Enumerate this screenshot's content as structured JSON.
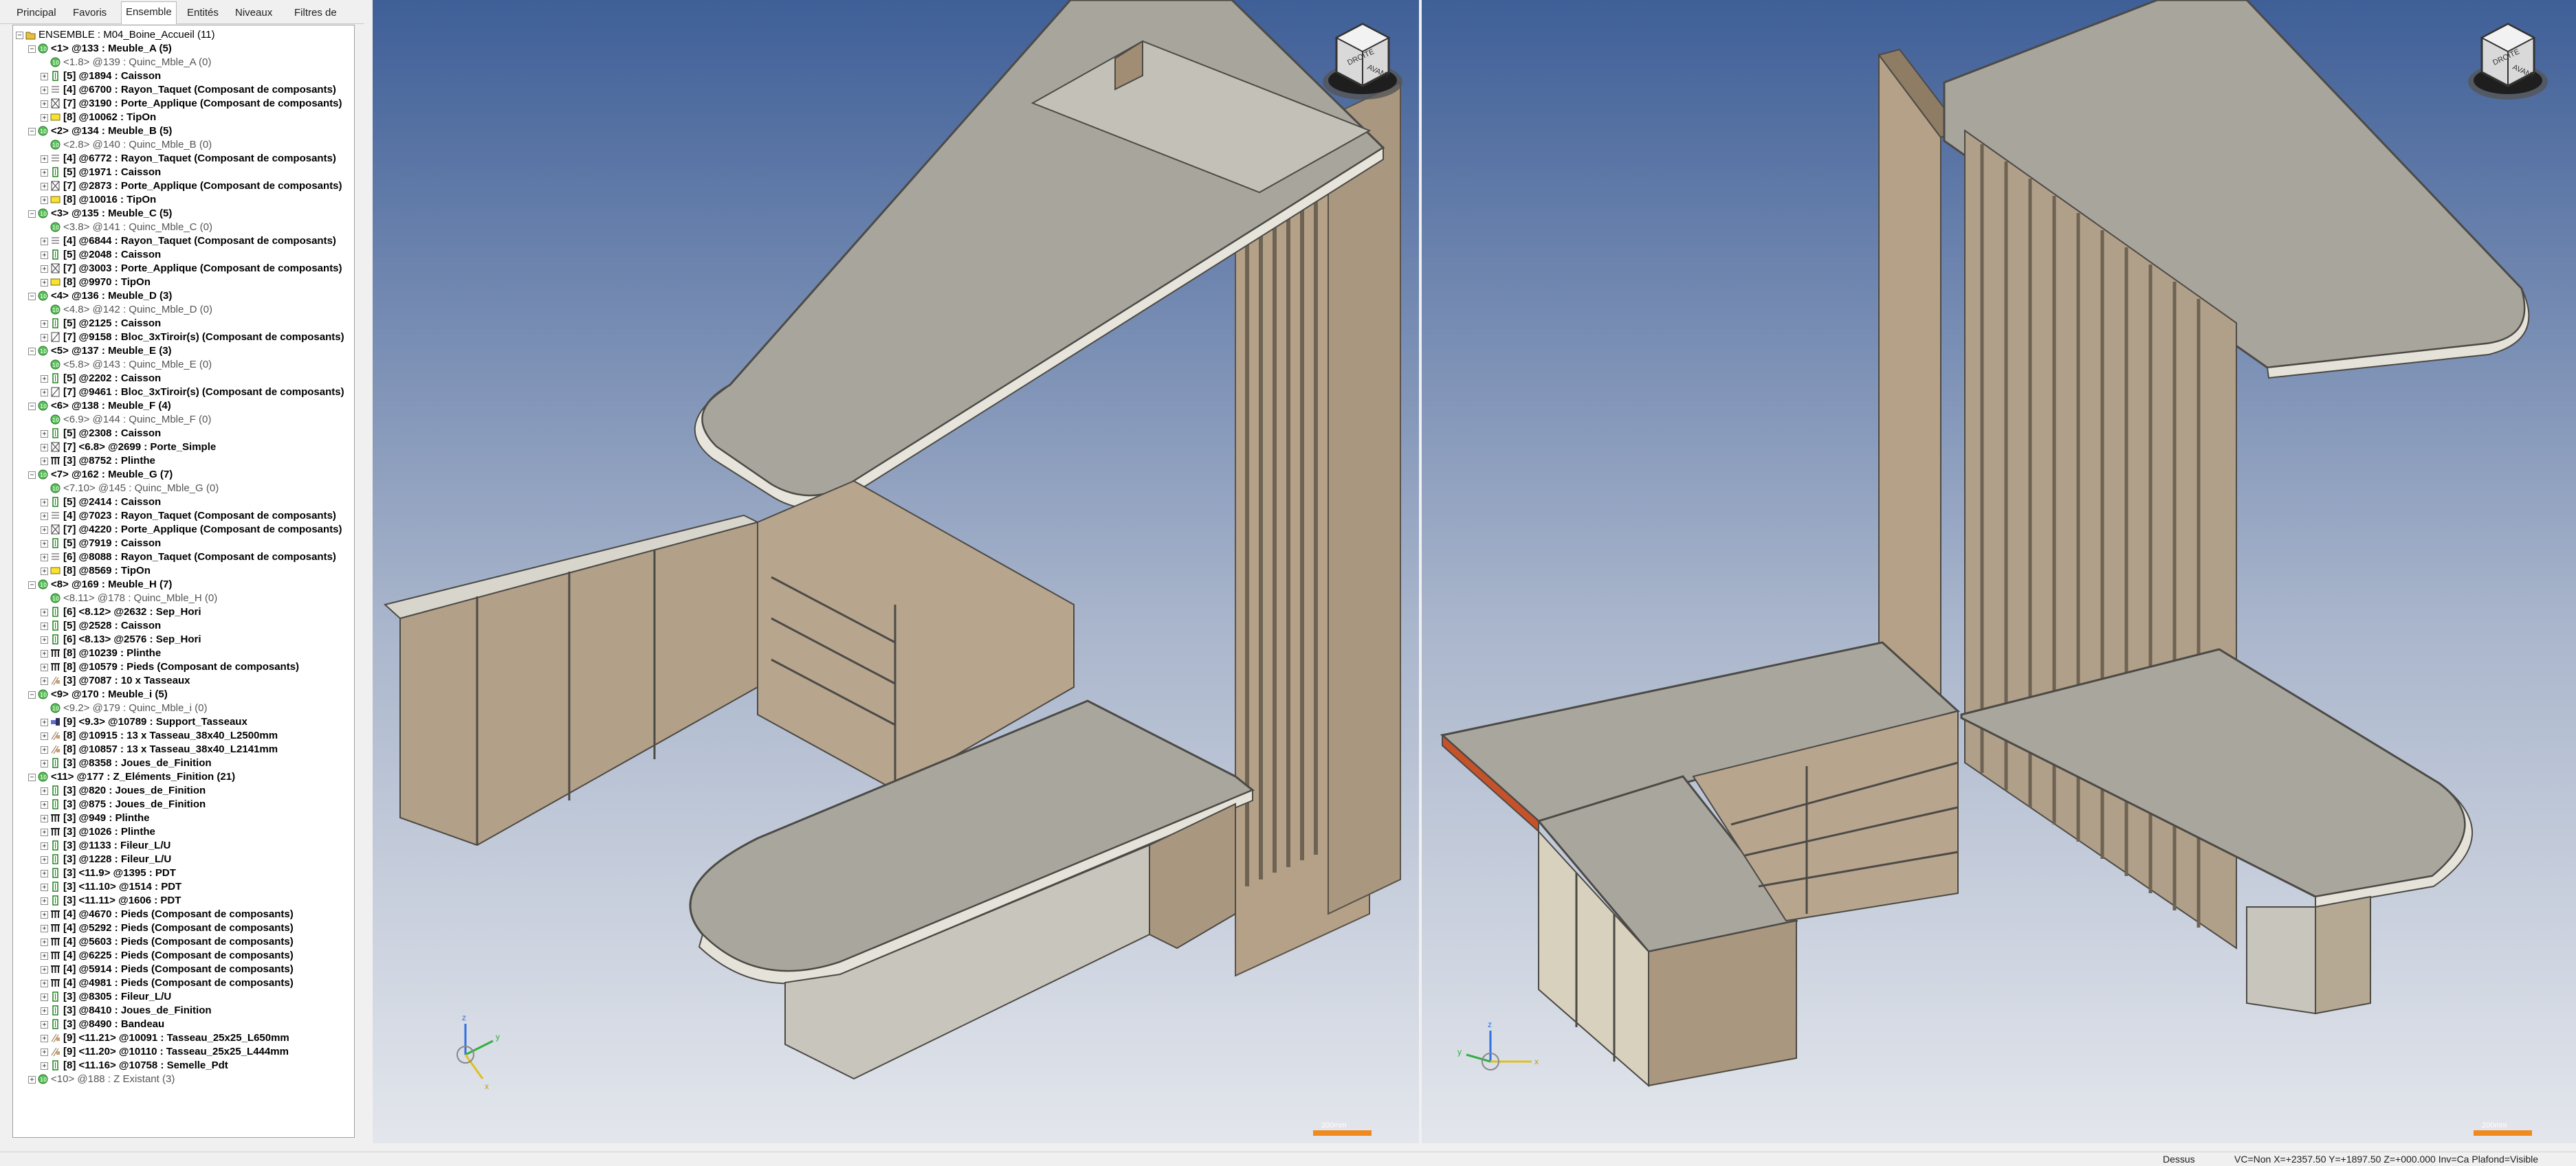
{
  "panel": {
    "tabs": [
      "Principal",
      "Favoris",
      "Ensemble",
      "Entités",
      "Niveaux",
      "Filtres de visualisation"
    ],
    "active_tab": "Ensemble",
    "tree": [
      {
        "level": 0,
        "toggle": "-",
        "icon": "folder",
        "text": "ENSEMBLE : M04_Boine_Accueil (11)",
        "style": "n"
      },
      {
        "level": 1,
        "toggle": "-",
        "icon": "assembly",
        "text": "<1> @133 : Meuble_A (5)",
        "style": "b"
      },
      {
        "level": 2,
        "toggle": "",
        "icon": "assembly",
        "text": "<1.8> @139 : Quinc_Mble_A (0)",
        "style": "g"
      },
      {
        "level": 2,
        "toggle": "+",
        "icon": "part",
        "text": "[5] @1894 : Caisson",
        "style": "b"
      },
      {
        "level": 2,
        "toggle": "+",
        "icon": "shelf",
        "text": "[4] @6700 : Rayon_Taquet (Composant de composants)",
        "style": "b"
      },
      {
        "level": 2,
        "toggle": "+",
        "icon": "door",
        "text": "[7] @3190 : Porte_Applique (Composant de composants)",
        "style": "b"
      },
      {
        "level": 2,
        "toggle": "+",
        "icon": "yellow",
        "text": "[8] @10062 : TipOn",
        "style": "b"
      },
      {
        "level": 1,
        "toggle": "-",
        "icon": "assembly",
        "text": "<2> @134 : Meuble_B (5)",
        "style": "b"
      },
      {
        "level": 2,
        "toggle": "",
        "icon": "assembly",
        "text": "<2.8> @140 : Quinc_Mble_B (0)",
        "style": "g"
      },
      {
        "level": 2,
        "toggle": "+",
        "icon": "shelf",
        "text": "[4] @6772 : Rayon_Taquet (Composant de composants)",
        "style": "b"
      },
      {
        "level": 2,
        "toggle": "+",
        "icon": "part",
        "text": "[5] @1971 : Caisson",
        "style": "b"
      },
      {
        "level": 2,
        "toggle": "+",
        "icon": "door",
        "text": "[7] @2873 : Porte_Applique (Composant de composants)",
        "style": "b"
      },
      {
        "level": 2,
        "toggle": "+",
        "icon": "yellow",
        "text": "[8] @10016 : TipOn",
        "style": "b"
      },
      {
        "level": 1,
        "toggle": "-",
        "icon": "assembly",
        "text": "<3> @135 : Meuble_C (5)",
        "style": "b"
      },
      {
        "level": 2,
        "toggle": "",
        "icon": "assembly",
        "text": "<3.8> @141 : Quinc_Mble_C (0)",
        "style": "g"
      },
      {
        "level": 2,
        "toggle": "+",
        "icon": "shelf",
        "text": "[4] @6844 : Rayon_Taquet (Composant de composants)",
        "style": "b"
      },
      {
        "level": 2,
        "toggle": "+",
        "icon": "part",
        "text": "[5] @2048 : Caisson",
        "style": "b"
      },
      {
        "level": 2,
        "toggle": "+",
        "icon": "door",
        "text": "[7] @3003 : Porte_Applique (Composant de composants)",
        "style": "b"
      },
      {
        "level": 2,
        "toggle": "+",
        "icon": "yellow",
        "text": "[8] @9970 : TipOn",
        "style": "b"
      },
      {
        "level": 1,
        "toggle": "-",
        "icon": "assembly",
        "text": "<4> @136 : Meuble_D (3)",
        "style": "b"
      },
      {
        "level": 2,
        "toggle": "",
        "icon": "assembly",
        "text": "<4.8> @142 : Quinc_Mble_D (0)",
        "style": "g"
      },
      {
        "level": 2,
        "toggle": "+",
        "icon": "part",
        "text": "[5] @2125 : Caisson",
        "style": "b"
      },
      {
        "level": 2,
        "toggle": "+",
        "icon": "drawer",
        "text": "[7] @9158 : Bloc_3xTiroir(s) (Composant de composants)",
        "style": "b"
      },
      {
        "level": 1,
        "toggle": "-",
        "icon": "assembly",
        "text": "<5> @137 : Meuble_E (3)",
        "style": "b"
      },
      {
        "level": 2,
        "toggle": "",
        "icon": "assembly",
        "text": "<5.8> @143 : Quinc_Mble_E (0)",
        "style": "g"
      },
      {
        "level": 2,
        "toggle": "+",
        "icon": "part",
        "text": "[5] @2202 : Caisson",
        "style": "b"
      },
      {
        "level": 2,
        "toggle": "+",
        "icon": "drawer",
        "text": "[7] @9461 : Bloc_3xTiroir(s) (Composant de composants)",
        "style": "b"
      },
      {
        "level": 1,
        "toggle": "-",
        "icon": "assembly",
        "text": "<6> @138 : Meuble_F (4)",
        "style": "b"
      },
      {
        "level": 2,
        "toggle": "",
        "icon": "assembly",
        "text": "<6.9> @144 : Quinc_Mble_F (0)",
        "style": "g"
      },
      {
        "level": 2,
        "toggle": "+",
        "icon": "part",
        "text": "[5] @2308 : Caisson",
        "style": "b"
      },
      {
        "level": 2,
        "toggle": "+",
        "icon": "door",
        "text": "[7] <6.8> @2699 : Porte_Simple",
        "style": "b"
      },
      {
        "level": 2,
        "toggle": "+",
        "icon": "plinth",
        "text": "[3] @8752 : Plinthe",
        "style": "b"
      },
      {
        "level": 1,
        "toggle": "-",
        "icon": "assembly",
        "text": "<7> @162 : Meuble_G (7)",
        "style": "b"
      },
      {
        "level": 2,
        "toggle": "",
        "icon": "assembly",
        "text": "<7.10> @145 : Quinc_Mble_G (0)",
        "style": "g"
      },
      {
        "level": 2,
        "toggle": "+",
        "icon": "part",
        "text": "[5] @2414 : Caisson",
        "style": "b"
      },
      {
        "level": 2,
        "toggle": "+",
        "icon": "shelf",
        "text": "[4] @7023 : Rayon_Taquet (Composant de composants)",
        "style": "b"
      },
      {
        "level": 2,
        "toggle": "+",
        "icon": "door",
        "text": "[7] @4220 : Porte_Applique (Composant de composants)",
        "style": "b"
      },
      {
        "level": 2,
        "toggle": "+",
        "icon": "part",
        "text": "[5] @7919 : Caisson",
        "style": "b"
      },
      {
        "level": 2,
        "toggle": "+",
        "icon": "shelf",
        "text": "[6] @8088 : Rayon_Taquet (Composant de composants)",
        "style": "b"
      },
      {
        "level": 2,
        "toggle": "+",
        "icon": "yellow",
        "text": "[8] @8569 : TipOn",
        "style": "b"
      },
      {
        "level": 1,
        "toggle": "-",
        "icon": "assembly",
        "text": "<8> @169 : Meuble_H (7)",
        "style": "b"
      },
      {
        "level": 2,
        "toggle": "",
        "icon": "assembly",
        "text": "<8.11> @178 : Quinc_Mble_H (0)",
        "style": "g"
      },
      {
        "level": 2,
        "toggle": "+",
        "icon": "part",
        "text": "[6] <8.12> @2632 : Sep_Hori",
        "style": "b"
      },
      {
        "level": 2,
        "toggle": "+",
        "icon": "part",
        "text": "[5] @2528 : Caisson",
        "style": "b"
      },
      {
        "level": 2,
        "toggle": "+",
        "icon": "part",
        "text": "[6] <8.13> @2576 : Sep_Hori",
        "style": "b"
      },
      {
        "level": 2,
        "toggle": "+",
        "icon": "plinth",
        "text": "[8] @10239 : Plinthe",
        "style": "b"
      },
      {
        "level": 2,
        "toggle": "+",
        "icon": "plinth",
        "text": "[8] @10579 : Pieds (Composant de composants)",
        "style": "b"
      },
      {
        "level": 2,
        "toggle": "+",
        "icon": "batten",
        "text": "[3] @7087 : 10 x Tasseaux",
        "style": "b"
      },
      {
        "level": 1,
        "toggle": "-",
        "icon": "assembly",
        "text": "<9> @170 : Meuble_i (5)",
        "style": "b"
      },
      {
        "level": 2,
        "toggle": "",
        "icon": "assembly",
        "text": "<9.2> @179 : Quinc_Mble_i (0)",
        "style": "g"
      },
      {
        "level": 2,
        "toggle": "+",
        "icon": "support",
        "text": "[9] <9.3> @10789 : Support_Tasseaux",
        "style": "b"
      },
      {
        "level": 2,
        "toggle": "+",
        "icon": "batten",
        "text": "[8] @10915 : 13 x Tasseau_38x40_L2500mm",
        "style": "b"
      },
      {
        "level": 2,
        "toggle": "+",
        "icon": "batten",
        "text": "[8] @10857 : 13 x Tasseau_38x40_L2141mm",
        "style": "b"
      },
      {
        "level": 2,
        "toggle": "+",
        "icon": "part",
        "text": "[3] @8358 : Joues_de_Finition",
        "style": "b"
      },
      {
        "level": 1,
        "toggle": "-",
        "icon": "assembly",
        "text": "<11> @177 : Z_Eléments_Finition (21)",
        "style": "b"
      },
      {
        "level": 2,
        "toggle": "+",
        "icon": "part",
        "text": "[3] @820 : Joues_de_Finition",
        "style": "b"
      },
      {
        "level": 2,
        "toggle": "+",
        "icon": "part",
        "text": "[3] @875 : Joues_de_Finition",
        "style": "b"
      },
      {
        "level": 2,
        "toggle": "+",
        "icon": "plinth",
        "text": "[3] @949 : Plinthe",
        "style": "b"
      },
      {
        "level": 2,
        "toggle": "+",
        "icon": "plinth",
        "text": "[3] @1026 : Plinthe",
        "style": "b"
      },
      {
        "level": 2,
        "toggle": "+",
        "icon": "part",
        "text": "[3] @1133 : Fileur_L/U",
        "style": "b"
      },
      {
        "level": 2,
        "toggle": "+",
        "icon": "part",
        "text": "[3] @1228 : Fileur_L/U",
        "style": "b"
      },
      {
        "level": 2,
        "toggle": "+",
        "icon": "part",
        "text": "[3] <11.9> @1395 : PDT",
        "style": "b"
      },
      {
        "level": 2,
        "toggle": "+",
        "icon": "part",
        "text": "[3] <11.10> @1514 : PDT",
        "style": "b"
      },
      {
        "level": 2,
        "toggle": "+",
        "icon": "part",
        "text": "[3] <11.11> @1606 : PDT",
        "style": "b"
      },
      {
        "level": 2,
        "toggle": "+",
        "icon": "plinth",
        "text": "[4] @4670 : Pieds (Composant de composants)",
        "style": "b"
      },
      {
        "level": 2,
        "toggle": "+",
        "icon": "plinth",
        "text": "[4] @5292 : Pieds (Composant de composants)",
        "style": "b"
      },
      {
        "level": 2,
        "toggle": "+",
        "icon": "plinth",
        "text": "[4] @5603 : Pieds (Composant de composants)",
        "style": "b"
      },
      {
        "level": 2,
        "toggle": "+",
        "icon": "plinth",
        "text": "[4] @6225 : Pieds (Composant de composants)",
        "style": "b"
      },
      {
        "level": 2,
        "toggle": "+",
        "icon": "plinth",
        "text": "[4] @5914 : Pieds (Composant de composants)",
        "style": "b"
      },
      {
        "level": 2,
        "toggle": "+",
        "icon": "plinth",
        "text": "[4] @4981 : Pieds (Composant de composants)",
        "style": "b"
      },
      {
        "level": 2,
        "toggle": "+",
        "icon": "part",
        "text": "[3] @8305 : Fileur_L/U",
        "style": "b"
      },
      {
        "level": 2,
        "toggle": "+",
        "icon": "part",
        "text": "[3] @8410 : Joues_de_Finition",
        "style": "b"
      },
      {
        "level": 2,
        "toggle": "+",
        "icon": "part",
        "text": "[3] @8490 : Bandeau",
        "style": "b"
      },
      {
        "level": 2,
        "toggle": "+",
        "icon": "batten",
        "text": "[9] <11.21> @10091 : Tasseau_25x25_L650mm",
        "style": "b"
      },
      {
        "level": 2,
        "toggle": "+",
        "icon": "batten",
        "text": "[9] <11.20> @10110 : Tasseau_25x25_L444mm",
        "style": "b"
      },
      {
        "level": 2,
        "toggle": "+",
        "icon": "part",
        "text": "[8] <11.16> @10758 : Semelle_Pdt",
        "style": "b"
      },
      {
        "level": 1,
        "toggle": "+",
        "icon": "assembly",
        "text": "<10> @188 : Z Existant (3)",
        "style": "g"
      }
    ]
  },
  "viewports": {
    "left": {
      "cube_faces": [
        "DROITE",
        "AVANT"
      ],
      "scale_label": "200mm"
    },
    "right": {
      "cube_faces": [
        "DROITE",
        "AVANT"
      ],
      "scale_label": "200mm"
    }
  },
  "status_bar": {
    "view": "Dessus",
    "coords": "VC=Non  X=+2357.50  Y=+1897.50  Z=+000.000  Inv=Ca  Plafond=Visible"
  },
  "colors": {
    "viewport_top": "#3f5f98",
    "viewport_bottom": "#dfe3ea",
    "countertop": "#a8a59d",
    "wood": "#b8a58c",
    "scale_bar": "#f08a1e"
  }
}
